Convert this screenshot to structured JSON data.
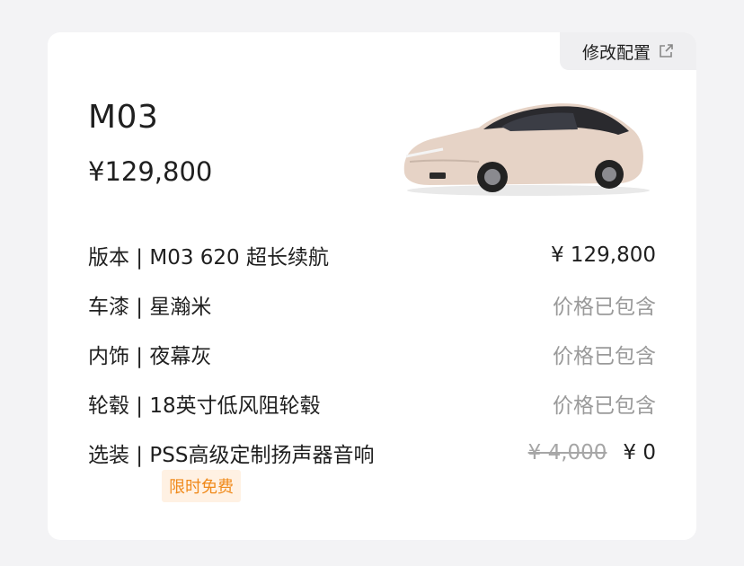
{
  "header": {
    "edit_label": "修改配置"
  },
  "summary": {
    "model": "M03",
    "price": "¥129,800"
  },
  "items": [
    {
      "label": "版本 | M03 620 超长续航",
      "value": "¥ 129,800"
    },
    {
      "label": "车漆 | 星瀚米",
      "value": "价格已包含"
    },
    {
      "label": "内饰 | 夜幕灰",
      "value": "价格已包含"
    },
    {
      "label": "轮毂 | 18英寸低风阻轮毂",
      "value": "价格已包含"
    }
  ],
  "option": {
    "label": "选装 | PSS高级定制扬声器音响",
    "original_price": "¥ 4,000",
    "price": "¥ 0",
    "tag": "限时免费"
  },
  "colors": {
    "tag_text": "#f08a1b",
    "tag_bg": "#fff1e3",
    "car_paint": "#e6d3c6"
  },
  "icons": {
    "edit": "external-edit-icon",
    "car": "car-image"
  }
}
